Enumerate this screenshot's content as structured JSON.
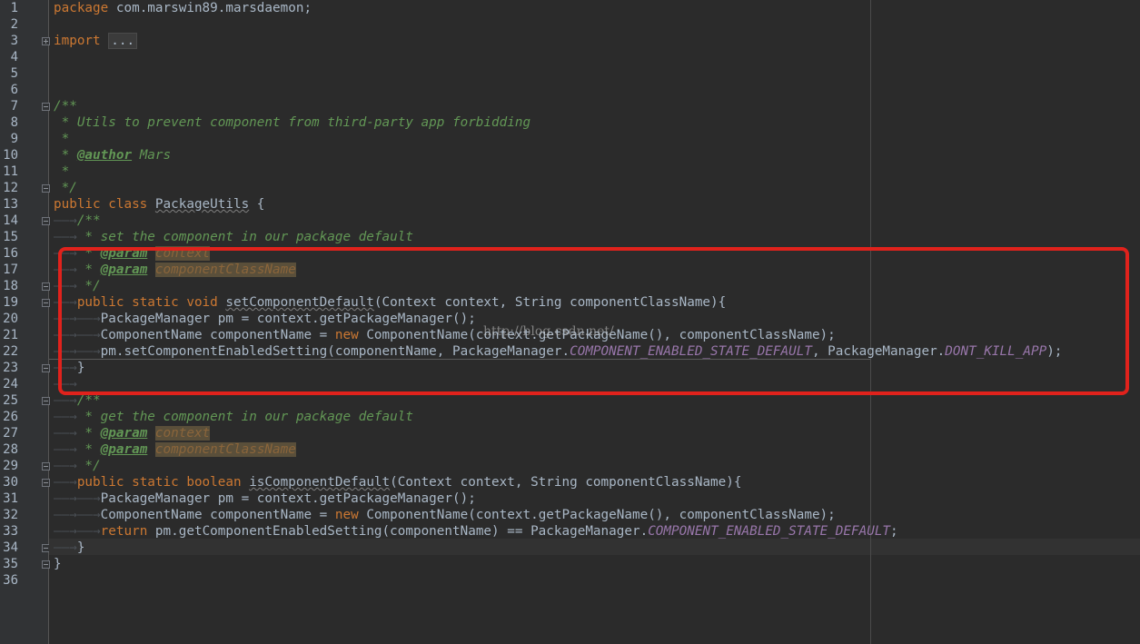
{
  "editor": {
    "line_numbers": [
      "1",
      "2",
      "3",
      "4",
      "5",
      "6",
      "7",
      "8",
      "9",
      "10",
      "11",
      "12",
      "13",
      "14",
      "15",
      "16",
      "17",
      "18",
      "19",
      "20",
      "21",
      "22",
      "23",
      "24",
      "25",
      "26",
      "27",
      "28",
      "29",
      "30",
      "31",
      "32",
      "33",
      "34",
      "35",
      "36"
    ],
    "watermark": "http://blog.csdn.net/",
    "tab_glyph": "——→",
    "icons": {
      "fold_collapsed": "plus-box-icon",
      "fold_expanded": "minus-box-icon",
      "tab_marker": "tab-arrow-icon"
    },
    "lines": [
      {
        "p": [
          "package",
          " com.marswin89.marsdaemon;"
        ]
      },
      {
        "p": []
      },
      {
        "p": [
          "import",
          " ",
          "..."
        ]
      },
      {
        "p": []
      },
      {
        "p": []
      },
      {
        "p": []
      },
      {
        "p": [
          "/**"
        ]
      },
      {
        "p": [
          " * Utils to prevent component from third-party app forbidding"
        ]
      },
      {
        "p": [
          " *"
        ]
      },
      {
        "p": [
          " * ",
          "@author",
          " Mars"
        ]
      },
      {
        "p": [
          " *"
        ]
      },
      {
        "p": [
          " */"
        ]
      },
      {
        "p": [
          "public class",
          " ",
          "PackageUtils",
          " {"
        ]
      },
      {
        "p": [
          "/**"
        ]
      },
      {
        "p": [
          " * set the component in our package default"
        ]
      },
      {
        "p": [
          " * ",
          "@param",
          " ",
          "context"
        ]
      },
      {
        "p": [
          " * ",
          "@param",
          " ",
          "componentClassName"
        ]
      },
      {
        "p": [
          " */"
        ]
      },
      {
        "p": [
          "public static void",
          " ",
          "setComponentDefault",
          "(Context context, String componentClassName){"
        ]
      },
      {
        "p": [
          "PackageManager pm = context.getPackageManager();"
        ]
      },
      {
        "p": [
          "ComponentName componentName = ",
          "new",
          " ComponentName(context.getPackageName(), componentClassName);"
        ]
      },
      {
        "p": [
          "pm.setComponentEnabledSetting(componentName, PackageManager.",
          "COMPONENT_ENABLED_STATE_DEFAULT",
          ", PackageManager.",
          "DONT_KILL_APP",
          ");"
        ]
      },
      {
        "p": [
          "}"
        ]
      },
      {
        "p": []
      },
      {
        "p": [
          "/**"
        ]
      },
      {
        "p": [
          " * get the component in our package default"
        ]
      },
      {
        "p": [
          " * ",
          "@param",
          " ",
          "context"
        ]
      },
      {
        "p": [
          " * ",
          "@param",
          " ",
          "componentClassName"
        ]
      },
      {
        "p": [
          " */"
        ]
      },
      {
        "p": [
          "public static boolean",
          " ",
          "isComponentDefault",
          "(Context context, String componentClassName){"
        ]
      },
      {
        "p": [
          "PackageManager pm = context.getPackageManager();"
        ]
      },
      {
        "p": [
          "ComponentName componentName = ",
          "new",
          " ComponentName(context.getPackageName(), componentClassName);"
        ]
      },
      {
        "p": [
          "return",
          " pm.getComponentEnabledSetting(componentName) == PackageManager.",
          "COMPONENT_ENABLED_STATE_DEFAULT",
          ";"
        ]
      },
      {
        "p": [
          "}"
        ]
      },
      {
        "p": [
          "}"
        ]
      },
      {
        "p": []
      }
    ]
  }
}
